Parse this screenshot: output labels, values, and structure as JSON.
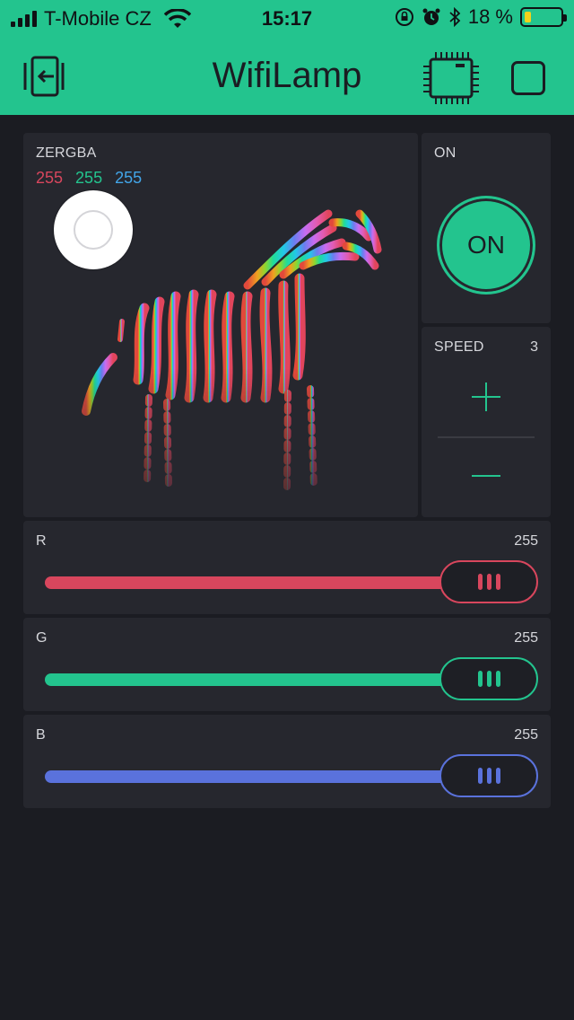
{
  "status_bar": {
    "carrier": "T-Mobile CZ",
    "time": "15:17",
    "battery_percent": "18 %",
    "battery_level": 0.18
  },
  "app": {
    "title": "WifiLamp"
  },
  "zergba": {
    "label": "ZERGBA",
    "r": "255",
    "g": "255",
    "b": "255"
  },
  "power": {
    "label": "ON",
    "button_label": "ON"
  },
  "speed": {
    "label": "SPEED",
    "value": "3"
  },
  "sliders": [
    {
      "label": "R",
      "value": "255",
      "level": 1.0,
      "color": "#d8465d"
    },
    {
      "label": "G",
      "value": "255",
      "level": 1.0,
      "color": "#23c48e"
    },
    {
      "label": "B",
      "value": "255",
      "level": 1.0,
      "color": "#5a72dc"
    }
  ],
  "colors": {
    "accent": "#23c48e",
    "red": "#d8465d",
    "green": "#23c48e",
    "blue": "#42a5e8",
    "background": "#1b1c22",
    "widget": "#26272e"
  },
  "icons": {
    "exit": "exit-icon",
    "board": "device-board-icon",
    "square": "stop-square-icon"
  }
}
